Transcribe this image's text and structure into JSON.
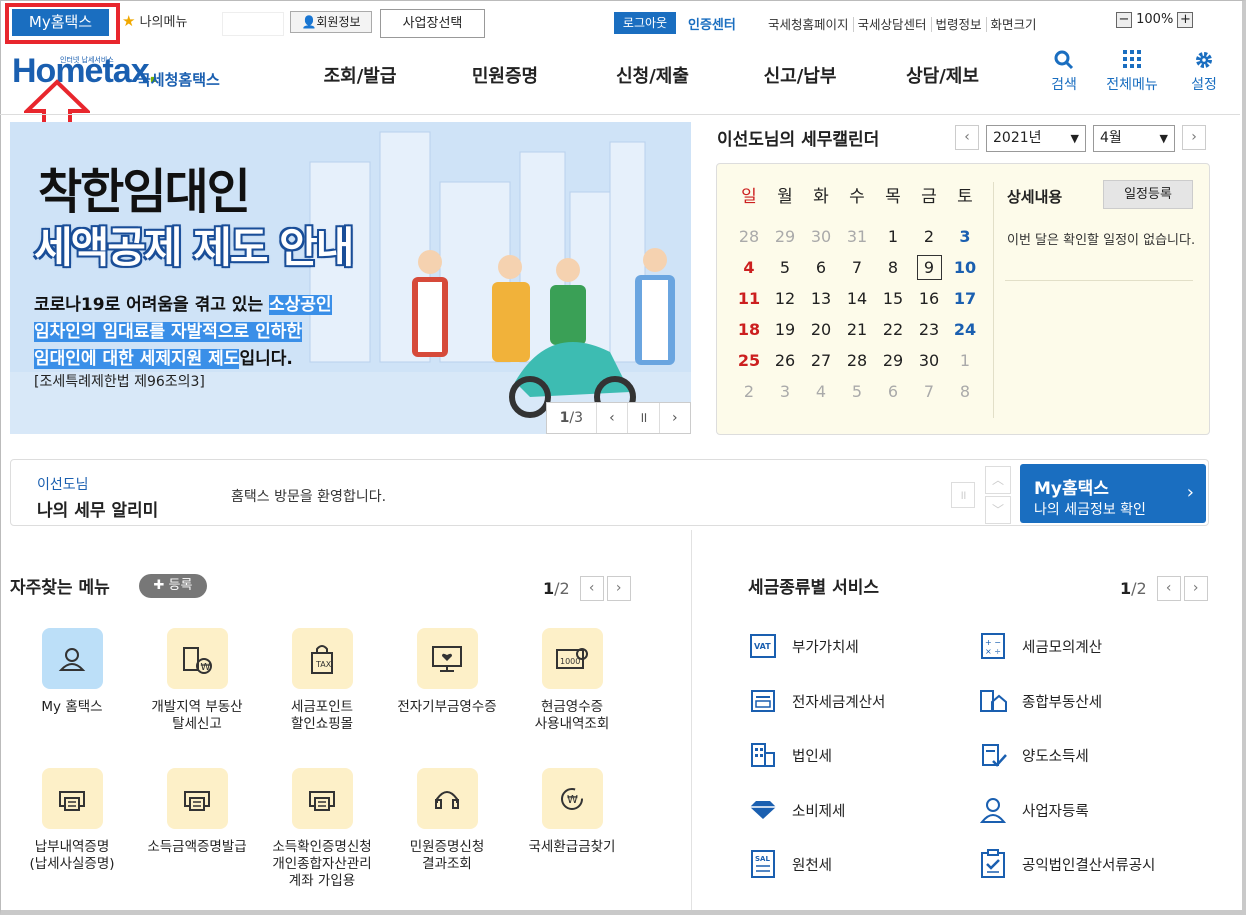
{
  "topbar": {
    "my_hometax": "My홈택스",
    "my_menu": "나의메뉴",
    "member_info": "회원정보",
    "business_select": "사업장선택",
    "logout": "로그아웃",
    "cert_center": "인증센터",
    "links": [
      "국세청홈페이지",
      "국세상담센터",
      "법령정보",
      "화면크기"
    ],
    "zoom_level": "100%"
  },
  "header": {
    "logo_main": "Hometax",
    "logo_tiny": "인터넷 납세서비스",
    "logo_sub": "국세청홈택스",
    "gnb": [
      "조회/발급",
      "민원증명",
      "신청/제출",
      "신고/납부",
      "상담/제보"
    ],
    "tools": [
      "검색",
      "전체메뉴",
      "설정"
    ]
  },
  "banner": {
    "title1": "착한임대인",
    "title2": "세액공제 제도 안내",
    "line1_a": "코로나19로 어려움을 겪고 있는 ",
    "line1_b": "소상공인",
    "line2": "임차인의 임대료를 자발적으로 인하한",
    "line3_a": "임대인에 대한 세제지원 제도",
    "line3_b": "입니다.",
    "law": "[조세특례제한법 제96조의3]",
    "page_current": "1",
    "page_total": "/3"
  },
  "calendar": {
    "title": "이선도님의 세무캘린더",
    "year": "2021년",
    "month": "4월",
    "weekdays": [
      "일",
      "월",
      "화",
      "수",
      "목",
      "금",
      "토"
    ],
    "weeks": [
      [
        "28",
        "29",
        "30",
        "31",
        "1",
        "2",
        "3"
      ],
      [
        "4",
        "5",
        "6",
        "7",
        "8",
        "9",
        "10"
      ],
      [
        "11",
        "12",
        "13",
        "14",
        "15",
        "16",
        "17"
      ],
      [
        "18",
        "19",
        "20",
        "21",
        "22",
        "23",
        "24"
      ],
      [
        "25",
        "26",
        "27",
        "28",
        "29",
        "30",
        "1"
      ],
      [
        "2",
        "3",
        "4",
        "5",
        "6",
        "7",
        "8"
      ]
    ],
    "detail_title": "상세내용",
    "register": "일정등록",
    "detail_text": "이번 달은 확인할 일정이 없습니다."
  },
  "alarm": {
    "user": "이선도님",
    "title": "나의 세무 알리미",
    "message": "홈택스 방문을 환영합니다.",
    "my_title": "My홈택스",
    "my_sub": "나의 세금정보 확인"
  },
  "favorites": {
    "title": "자주찾는 메뉴",
    "register": "등록",
    "page_current": "1",
    "page_total": "/2",
    "items": [
      {
        "label": "My 홈택스"
      },
      {
        "label": "개발지역 부동산\n탈세신고"
      },
      {
        "label": "세금포인트\n할인쇼핑몰"
      },
      {
        "label": "전자기부금영수증"
      },
      {
        "label": "현금영수증\n사용내역조회"
      },
      {
        "label": "납부내역증명\n(납세사실증명)"
      },
      {
        "label": "소득금액증명발급"
      },
      {
        "label": "소득확인증명신청\n개인종합자산관리\n계좌 가입용"
      },
      {
        "label": "민원증명신청\n결과조회"
      },
      {
        "label": "국세환급금찾기"
      }
    ]
  },
  "tax_services": {
    "title": "세금종류별 서비스",
    "page_current": "1",
    "page_total": "/2",
    "items": [
      "부가가치세",
      "세금모의계산",
      "전자세금계산서",
      "종합부동산세",
      "법인세",
      "양도소득세",
      "소비제세",
      "사업자등록",
      "원천세",
      "공익법인결산서류공시"
    ]
  }
}
